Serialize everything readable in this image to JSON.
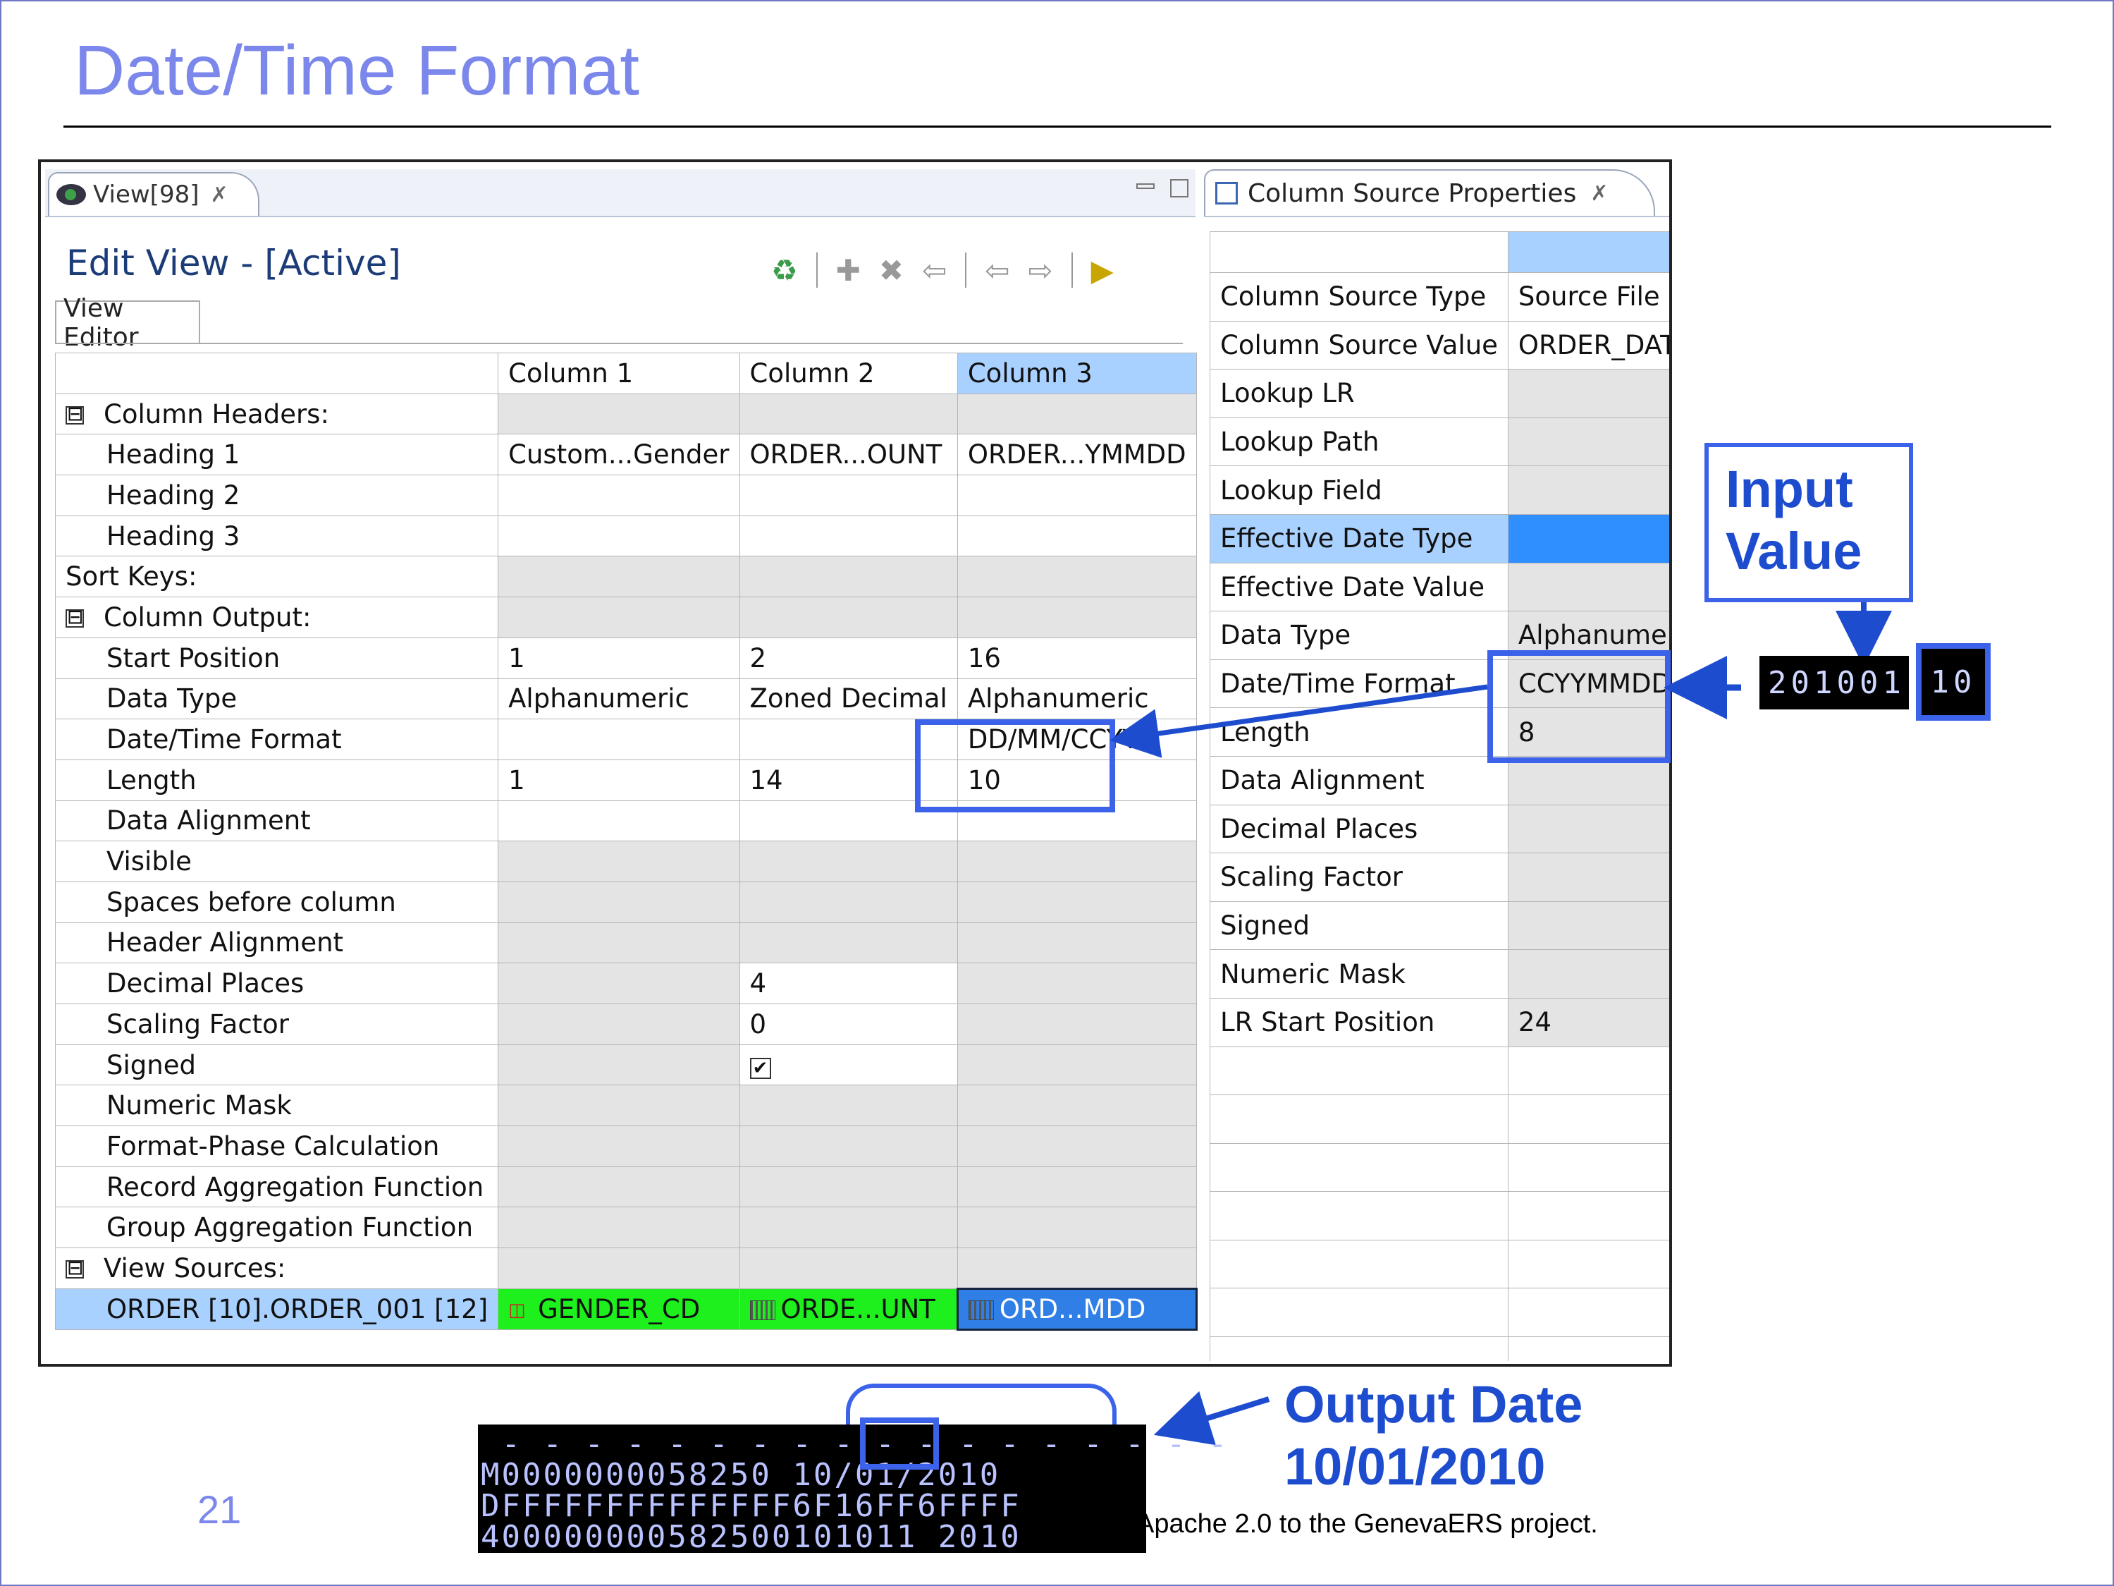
{
  "slide": {
    "title": "Date/Time Format",
    "page_number": "21",
    "footer": "Apache 2.0 to the GenevaERS project."
  },
  "view_panel": {
    "tab_label": "View[98]",
    "tab_close": "✗",
    "title": "Edit View - [Active]",
    "editor_tab": "View Editor",
    "columns": [
      "Column 1",
      "Column 2",
      "Column 3"
    ],
    "rows": [
      {
        "label": "Column Headers:",
        "expander": "⊟",
        "values": [
          "",
          "",
          ""
        ]
      },
      {
        "label": "Heading 1",
        "values": [
          "Custom...Gender",
          "ORDER...OUNT",
          "ORDER...YMMDD"
        ]
      },
      {
        "label": "Heading 2",
        "values": [
          "",
          "",
          ""
        ]
      },
      {
        "label": "Heading 3",
        "values": [
          "",
          "",
          ""
        ]
      },
      {
        "label": "Sort Keys:",
        "values": [
          "",
          "",
          ""
        ]
      },
      {
        "label": "Column Output:",
        "expander": "⊟",
        "values": [
          "",
          "",
          ""
        ]
      },
      {
        "label": "Start Position",
        "values": [
          "1",
          "2",
          "16"
        ]
      },
      {
        "label": "Data Type",
        "values": [
          "Alphanumeric",
          "Zoned Decimal",
          "Alphanumeric"
        ]
      },
      {
        "label": "Date/Time Format",
        "values": [
          "",
          "",
          "DD/MM/CCYY"
        ]
      },
      {
        "label": "Length",
        "values": [
          "1",
          "14",
          "10"
        ]
      },
      {
        "label": "Data Alignment",
        "values": [
          "",
          "",
          ""
        ]
      },
      {
        "label": "Visible",
        "values": [
          "",
          "",
          ""
        ]
      },
      {
        "label": "Spaces before column",
        "values": [
          "",
          "",
          ""
        ]
      },
      {
        "label": "Header Alignment",
        "values": [
          "",
          "",
          ""
        ]
      },
      {
        "label": "Decimal Places",
        "values": [
          "",
          "4",
          ""
        ]
      },
      {
        "label": "Scaling Factor",
        "values": [
          "",
          "0",
          ""
        ]
      },
      {
        "label": "Signed",
        "values": [
          "",
          "✔",
          ""
        ]
      },
      {
        "label": "Numeric Mask",
        "values": [
          "",
          "",
          ""
        ]
      },
      {
        "label": "Format-Phase Calculation",
        "values": [
          "",
          "",
          ""
        ]
      },
      {
        "label": "Record Aggregation Function",
        "values": [
          "",
          "",
          ""
        ]
      },
      {
        "label": "Group Aggregation Function",
        "values": [
          "",
          "",
          ""
        ]
      },
      {
        "label": "View Sources:",
        "expander": "⊟",
        "values": [
          "",
          "",
          ""
        ]
      },
      {
        "label": "ORDER [10].ORDER_001 [12]",
        "values": [
          "GENDER_CD",
          "ORDE...UNT",
          "ORD...MDD"
        ]
      }
    ]
  },
  "prop_panel": {
    "tab_label": "Column Source Properties",
    "tab_close": "✗",
    "rows": [
      {
        "label": "Column Source Type",
        "value": "Source File Field"
      },
      {
        "label": "Column Source Value",
        "value": "ORDER_DATE_CCYYMMDD"
      },
      {
        "label": "Lookup LR",
        "value": ""
      },
      {
        "label": "Lookup Path",
        "value": ""
      },
      {
        "label": "Lookup Field",
        "value": ""
      },
      {
        "label": "Effective Date Type",
        "value": ""
      },
      {
        "label": "Effective Date Value",
        "value": ""
      },
      {
        "label": "Data Type",
        "value": "Alphanumeric"
      },
      {
        "label": "Date/Time Format",
        "value": "CCYYMMDD"
      },
      {
        "label": "Length",
        "value": "8"
      },
      {
        "label": "Data Alignment",
        "value": ""
      },
      {
        "label": "Decimal Places",
        "value": ""
      },
      {
        "label": "Scaling Factor",
        "value": ""
      },
      {
        "label": "Signed",
        "value": ""
      },
      {
        "label": "Numeric Mask",
        "value": ""
      },
      {
        "label": "LR Start Position",
        "value": "24"
      }
    ]
  },
  "annotations": {
    "input_label": "Input\nValue",
    "input_value_prefix": "201001",
    "input_value_hl": "10",
    "output_label": "Output Date\n10/01/2010",
    "dump_lines": [
      " - - - - - - - - - - - - - - - - - -",
      "M0000000058250 10/01/2010",
      "DFFFFFFFFFFFFFF6F16FF6FFFF",
      "400000000582500101011 2010"
    ]
  },
  "colors": {
    "accent": "#3b62e8",
    "title": "#7b87ea",
    "selection": "#a9d1ff",
    "green_cell": "#1ef01e",
    "arrow": "#1d4ccf"
  }
}
